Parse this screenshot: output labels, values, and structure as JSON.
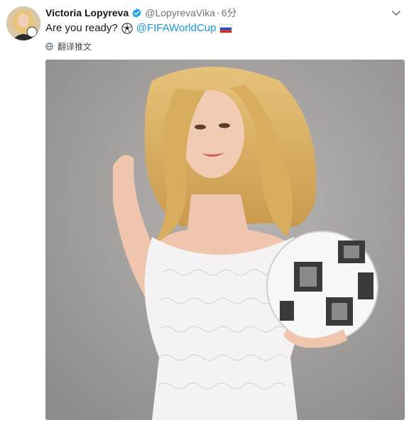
{
  "tweet": {
    "author_name": "Victoria Lopyreva",
    "author_handle": "@LopyrevaVika",
    "separator": "·",
    "timestamp": "6分",
    "text_before": "Are you ready?",
    "mention": "@FIFAWorldCup",
    "translate_label": "翻译推文",
    "icons": {
      "verified": "verified-badge-icon",
      "soccer": "soccer-ball-emoji",
      "flag": "russia-flag-emoji",
      "globe": "globe-icon",
      "caret": "chevron-down-icon"
    },
    "colors": {
      "link": "#1b95e0",
      "verified": "#1da1f2",
      "muted": "#657786"
    }
  }
}
